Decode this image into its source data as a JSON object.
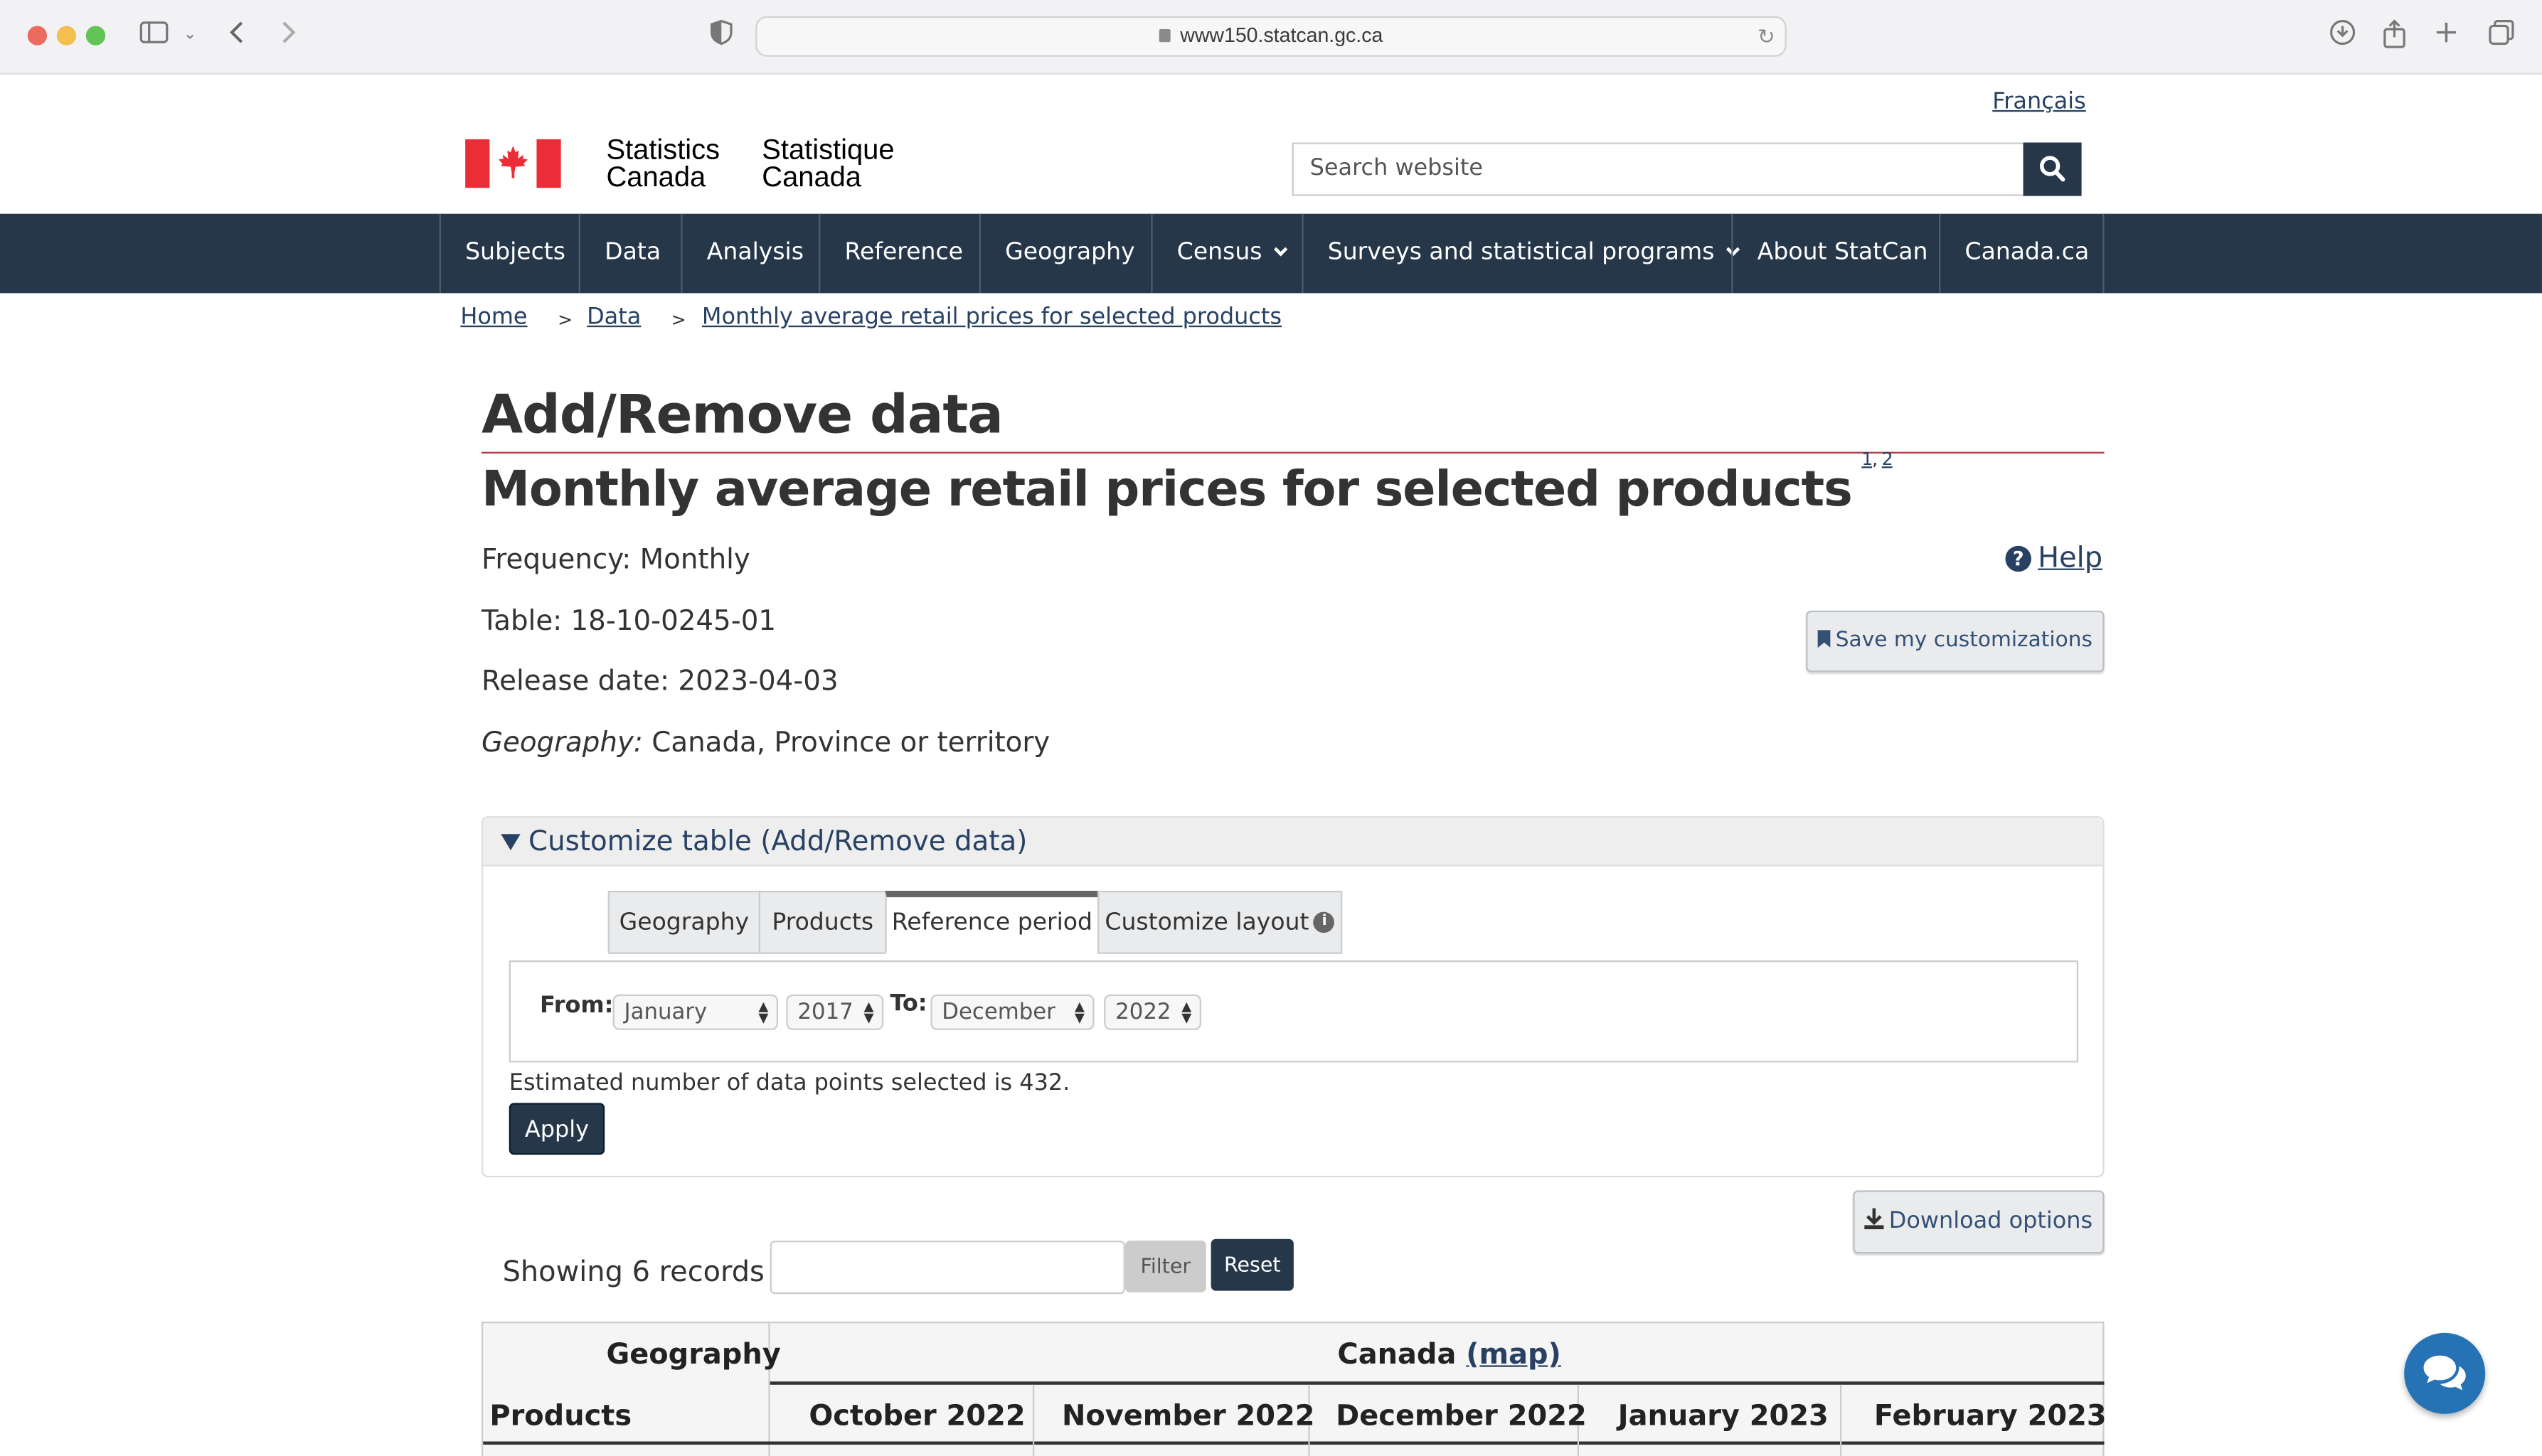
{
  "browser": {
    "url": "www150.statcan.gc.ca"
  },
  "header": {
    "language_link": "Français",
    "signature_en_1": "Statistics",
    "signature_en_2": "Canada",
    "signature_fr_1": "Statistique",
    "signature_fr_2": "Canada",
    "search_placeholder": "Search website"
  },
  "nav": {
    "items": [
      {
        "label": "Subjects"
      },
      {
        "label": "Data"
      },
      {
        "label": "Analysis"
      },
      {
        "label": "Reference"
      },
      {
        "label": "Geography"
      },
      {
        "label": "Census"
      },
      {
        "label": "Surveys and statistical programs"
      },
      {
        "label": "About StatCan"
      },
      {
        "label": "Canada.ca"
      }
    ]
  },
  "breadcrumb": [
    "Home",
    "Data",
    "Monthly average retail prices for selected products"
  ],
  "page": {
    "title": "Add/Remove data",
    "subtitle": "Monthly average retail prices for selected products",
    "footnote_1": "1",
    "footnote_2": "2",
    "frequency": "Frequency: Monthly",
    "table": "Table: 18-10-0245-01",
    "release_date": "Release date: 2023-04-03",
    "geography_label": "Geography:",
    "geography_value": " Canada, Province or territory",
    "help": "Help",
    "save_button": "Save my customizations"
  },
  "customize": {
    "heading": "Customize table (Add/Remove data)",
    "tabs": [
      "Geography",
      "Products",
      "Reference period",
      "Customize layout"
    ],
    "active_tab": "Reference period",
    "from_label": "From:",
    "to_label": "To:",
    "from_month": "January",
    "from_year": "2017",
    "to_month": "December",
    "to_year": "2022",
    "estimate": "Estimated number of data points selected is 432.",
    "apply": "Apply"
  },
  "records": {
    "download": "Download options",
    "showing": "Showing 6 records",
    "filter": "Filter",
    "reset": "Reset",
    "filter_value": ""
  },
  "table": {
    "geography_header": "Geography",
    "canada": "Canada",
    "map_link": "(map)",
    "products_header": "Products",
    "columns": [
      "October 2022",
      "November 2022",
      "December 2022",
      "January 2023",
      "February 2023"
    ]
  },
  "colors": {
    "nav_bg": "#26374a",
    "link": "#284162",
    "flag_red": "#eb2d37",
    "rule": "#af3c43",
    "chat_bg": "#2572b4"
  }
}
